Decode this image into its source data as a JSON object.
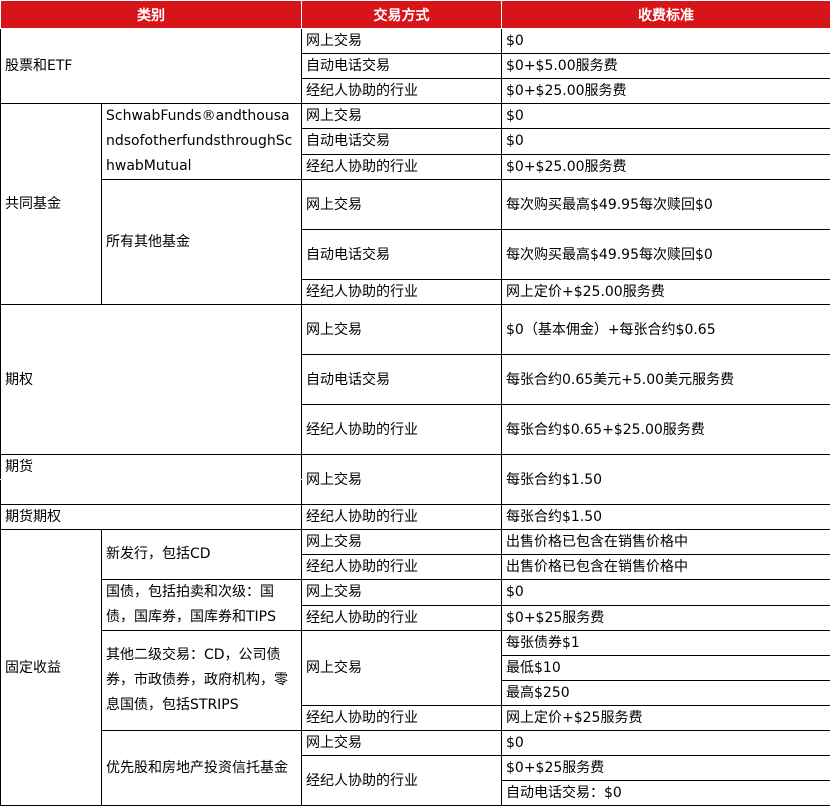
{
  "header": {
    "category": "类别",
    "method": "交易方式",
    "fee": "收费标准"
  },
  "stocks": {
    "name": "股票和ETF",
    "rows": [
      {
        "method": "网上交易",
        "fee": "$0"
      },
      {
        "method": "自动电话交易",
        "fee": "$0+$5.00服务费"
      },
      {
        "method": "经纪人协助的行业",
        "fee": "$0+$25.00服务费"
      }
    ]
  },
  "funds": {
    "name": "共同基金",
    "schwab": {
      "name": "SchwabFunds®andthousandsofotherfundsthroughSchwabMutual",
      "rows": [
        {
          "method": "网上交易",
          "fee": "$0"
        },
        {
          "method": "自动电话交易",
          "fee": "$0"
        },
        {
          "method": "经纪人协助的行业",
          "fee": "$0+$25.00服务费"
        }
      ]
    },
    "other": {
      "name": "所有其他基金",
      "rows": [
        {
          "method": "网上交易",
          "fee": "每次购买最高$49.95每次赎回$0"
        },
        {
          "method": "自动电话交易",
          "fee": "每次购买最高$49.95每次赎回$0"
        },
        {
          "method": "经纪人协助的行业",
          "fee": "网上定价+$25.00服务费"
        }
      ]
    }
  },
  "options": {
    "name": "期权",
    "rows": [
      {
        "method": "网上交易",
        "fee": "$0（基本佣金）+每张合约$0.65"
      },
      {
        "method": "自动电话交易",
        "fee": "每张合约0.65美元+5.00美元服务费"
      },
      {
        "method": "经纪人协助的行业",
        "fee": "每张合约$0.65+$25.00服务费"
      }
    ]
  },
  "futures": {
    "name": "期货",
    "method": "网上交易",
    "fee": "每张合约$1.50"
  },
  "futures_options": {
    "name": "期货期权",
    "method": "经纪人协助的行业",
    "fee": "每张合约$1.50"
  },
  "fixed_income": {
    "name": "固定收益",
    "new_issue": {
      "name": "新发行，包括CD",
      "rows": [
        {
          "method": "网上交易",
          "fee": "出售价格已包含在销售价格中"
        },
        {
          "method": "经纪人协助的行业",
          "fee": "出售价格已包含在销售价格中"
        }
      ]
    },
    "treasury": {
      "name": "国债，包括拍卖和次级：国债，国库券，国库券和TIPS",
      "rows": [
        {
          "method": "网上交易",
          "fee": "$0"
        },
        {
          "method": "经纪人协助的行业",
          "fee": "$0+$25服务费"
        }
      ]
    },
    "secondary": {
      "name": "其他二级交易：CD，公司债券，市政债券，政府机构，零息国债，包括STRIPS",
      "online_method": "网上交易",
      "online_fees": [
        "每张债券$1",
        "最低$10",
        "最高$250"
      ],
      "broker_method": "经纪人协助的行业",
      "broker_fee": "网上定价+$25服务费"
    },
    "preferred": {
      "name": "优先股和房地产投资信托基金",
      "online_method": "网上交易",
      "online_fee": "$0",
      "broker_method": "经纪人协助的行业",
      "broker_fees": [
        "$0+$25服务费",
        "自动电话交易：$0"
      ]
    }
  }
}
